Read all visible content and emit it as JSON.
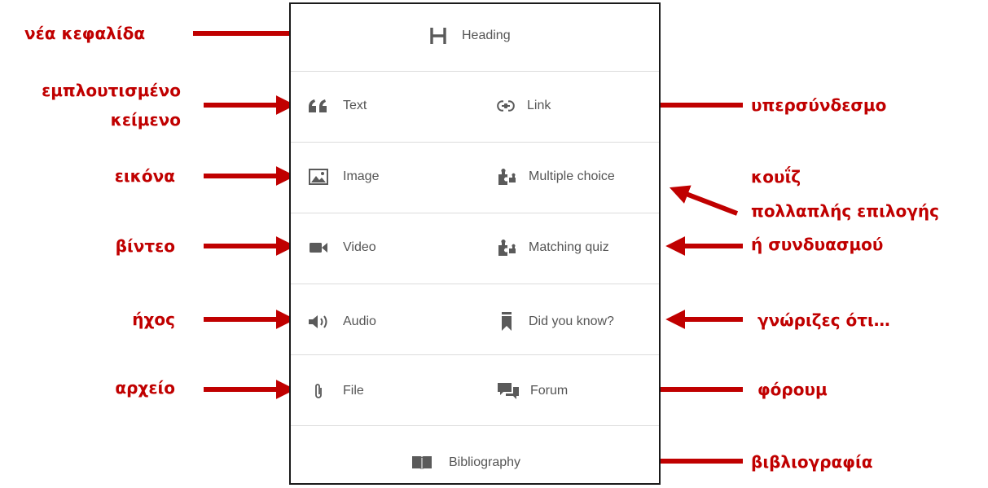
{
  "panel": {
    "heading": {
      "label": "Heading",
      "icon": "heading-icon"
    },
    "text": {
      "label": "Text",
      "icon": "quote-icon"
    },
    "link": {
      "label": "Link",
      "icon": "link-icon"
    },
    "image": {
      "label": "Image",
      "icon": "image-icon"
    },
    "multiple_choice": {
      "label": "Multiple choice",
      "icon": "puzzle-icon"
    },
    "video": {
      "label": "Video",
      "icon": "video-camera-icon"
    },
    "matching_quiz": {
      "label": "Matching quiz",
      "icon": "puzzle-icon"
    },
    "audio": {
      "label": "Audio",
      "icon": "speaker-icon"
    },
    "did_you_know": {
      "label": "Did you know?",
      "icon": "bookmark-icon"
    },
    "file": {
      "label": "File",
      "icon": "paperclip-icon"
    },
    "forum": {
      "label": "Forum",
      "icon": "chat-bubbles-icon"
    },
    "bibliography": {
      "label": "Bibliography",
      "icon": "book-icon"
    }
  },
  "annotations": {
    "heading": "νέα κεφαλίδα",
    "text_line1": "εμπλουτισμένο",
    "text_line2": "κείμενο",
    "link": "υπερσύνδεσμο",
    "image": "εικόνα",
    "quiz_line1": "κουΐζ",
    "quiz_line2": "πολλαπλής επιλογής",
    "quiz_line3": "ή συνδυασμού",
    "video": "βίντεο",
    "audio": "ήχος",
    "did_you_know": "γνώριζες ότι…",
    "file": "αρχείο",
    "forum": "φόρουμ",
    "bibliography": "βιβλιογραφία"
  },
  "colors": {
    "annotation": "#c00000",
    "panel_border": "#1a1a1a",
    "divider": "#dcdcdc",
    "item_text": "#555555",
    "icon": "#5a5a5a"
  }
}
